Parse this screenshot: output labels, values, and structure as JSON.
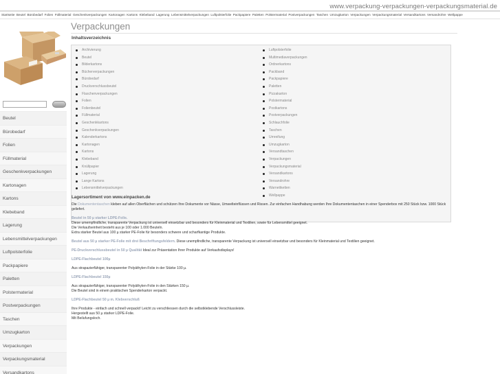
{
  "header": {
    "site_url": "www.verpackung-verpackungen-verpackungsmaterial.de",
    "nav": [
      "Startseite",
      "Beutel",
      "Bürobedarf",
      "Folien",
      "Füllmaterial",
      "Geschenkverpackungen",
      "Kartonagen",
      "Kartons",
      "Klebeband",
      "Lagerung",
      "Lebensmittelverpackungen",
      "Luftpolsterfolie",
      "Packpapiere",
      "Paletten",
      "Polstermaterial",
      "Postverpackungen",
      "Taschen",
      "Umzugkarton",
      "Verpackungen",
      "Verpackungsmaterial",
      "Versandkartons",
      "Versandrohre",
      "Wellpappe"
    ]
  },
  "sidebar": {
    "search_placeholder": "",
    "items": [
      "Beutel",
      "Bürobedarf",
      "Folien",
      "Füllmaterial",
      "Geschenkverpackungen",
      "Kartonagen",
      "Kartons",
      "Klebeband",
      "Lagerung",
      "Lebensmittelverpackungen",
      "Luftpolsterfolie",
      "Packpapiere",
      "Paletten",
      "Polstermaterial",
      "Postverpackungen",
      "Taschen",
      "Umzugkarton",
      "Verpackungen",
      "Verpackungsmaterial",
      "Versandkartons"
    ]
  },
  "main": {
    "title": "Verpackungen",
    "toc_heading": "Inhaltsverzeichnis",
    "toc_left": [
      "Archivierung",
      "Beutel",
      "Bilderkartons",
      "Bücherverpackungen",
      "Bürobedarf",
      "Druckverschlussbeutel",
      "Flaschenverpackungen",
      "Folien",
      "Folienbeutel",
      "Füllmaterial",
      "Geschenkkartons",
      "Geschenkverpackungen",
      "Kalenderkartons",
      "Kartonagen",
      "Kartons",
      "Klebeband",
      "Knüllpapier",
      "Lagerung",
      "Lange Kartons",
      "Lebensmittelverpackungen"
    ],
    "toc_right": [
      "Luftpolsterfolie",
      "Multimediaverpackungen",
      "Ordnerkartons",
      "Packband",
      "Packpapiere",
      "Paletten",
      "Pizzakarton",
      "Polstermaterial",
      "Postkartons",
      "Postverpackungen",
      "Schlauchfolie",
      "Taschen",
      "Umreifung",
      "Umzugkarton",
      "Versandtaschen",
      "Verpackungen",
      "Verpackungsmaterial",
      "Versandkartons",
      "Versandrohre",
      "Warnetiketten",
      "Wellpappe"
    ],
    "content": {
      "heading": "Lagersortiment von www.einpacken.de",
      "p1_prefix": "Die ",
      "p1_link": "Dokumententaschen",
      "p1_text": " kleben auf allen Oberflächen und schützen Ihre Dokumente vor Nässe, Umwelteinflüssen und Rissen. Zur einfachen Handhabung werden Ihre Dokumententaschen in einer Spenderbox mit 250 Stück bzw. 1000 Stück geliefert.",
      "p2_link": "Beutel in 50 µ starker LDPE-Folie.",
      "p2_line1": "Diese umempfindliche, transparente Verpackung ist universell einsetzbar und besonders für Kleinmaterial und Textilien, sowie für Lebensmittel geeignet.",
      "p2_line2": "Die Verkaufseinheit besteht aus je 100 oder 1.000 Beuteln.",
      "p2_line3": "Extra starker Beutel aus 100 µ starker PE-Folie für besonders schwere und scharfkantige Produkte.",
      "p3_link": "Beutel aus 50 µ starker PE-Folie mit drei Beschriftungsfeldern.",
      "p3_text": " Diese unempfindliche, transparente Verpackung ist universell einsetzbar und besonders für Kleinmaterial und Textilien geeignet.",
      "p4_link": "PE-Druckverschlussbeutel in 50 µ Qualität",
      "p4_text": " Ideal zur Präsentation Ihrer Produkte auf Verkaufsdisplays!",
      "sub1": "LDPE-Flachbeutel 100µ",
      "sub1_text": "Aus strapazierfähiger, transparenter Polyäthylen-Folie in der Stärke 100 µ.",
      "sub2": "LDPE-Flachbeutel 150µ",
      "sub2_line1": "Aus strapazierfähiger, transparenter Polyäthylen-Folie in den Stärken 150 µ.",
      "sub2_line2": "Die Beutel sind in einem praktischen Spenderkarton verpackt.",
      "sub3": "LDPE-Flachbeutel 50 µ m. Klebverschluß",
      "sub3_line1": "Ihre Produkte - einfach und schnell verpackt! Leicht zu verschliessen durch die selbstklebende Verschlussleiste.",
      "sub3_line2": "Hergestellt aus 50 µ starker LDPE-Folie.",
      "sub3_line3": "Mit Beilufungsloch."
    }
  }
}
